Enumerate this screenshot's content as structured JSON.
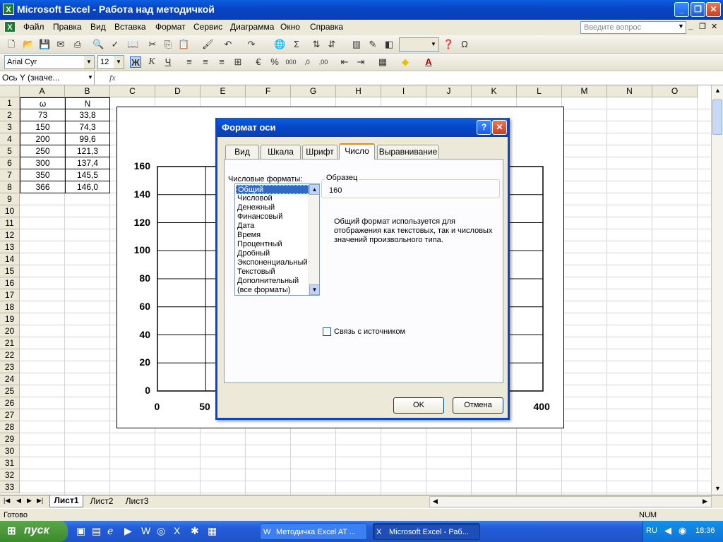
{
  "window": {
    "title": "Microsoft Excel - Работа над методичкой",
    "minimize": "_",
    "restore": "❐",
    "close": "✕"
  },
  "menu": {
    "items": [
      "Файл",
      "Правка",
      "Вид",
      "Вставка",
      "Формат",
      "Сервис",
      "Диаграмма",
      "Окно",
      "Справка"
    ],
    "question_placeholder": "Введите вопрос"
  },
  "format_toolbar": {
    "font": "Arial Cyr",
    "size": "12",
    "bold": "Ж",
    "italic": "К",
    "underline": "Ч"
  },
  "formula_bar": {
    "name_box": "Ось Y (значе...",
    "fx": "fx"
  },
  "columns": [
    "A",
    "B",
    "C",
    "D",
    "E",
    "F",
    "G",
    "H",
    "I",
    "J",
    "K",
    "L",
    "M",
    "N",
    "O"
  ],
  "rows": [
    "1",
    "2",
    "3",
    "4",
    "5",
    "6",
    "7",
    "8",
    "9",
    "10",
    "11",
    "12",
    "13",
    "14",
    "15",
    "16",
    "17",
    "18",
    "19",
    "20",
    "21",
    "22",
    "23",
    "24",
    "25",
    "26",
    "27",
    "28",
    "29",
    "30",
    "31",
    "32",
    "33"
  ],
  "table": {
    "headers": [
      "ω",
      "N"
    ],
    "data": [
      [
        "73",
        "33,8"
      ],
      [
        "150",
        "74,3"
      ],
      [
        "200",
        "99,6"
      ],
      [
        "250",
        "121,3"
      ],
      [
        "300",
        "137,4"
      ],
      [
        "350",
        "145,5"
      ],
      [
        "366",
        "146,0"
      ]
    ]
  },
  "chart_data": {
    "type": "scatter",
    "y_ticks": [
      "160",
      "140",
      "120",
      "100",
      "80",
      "60",
      "40",
      "20",
      "0"
    ],
    "x_ticks": [
      "0",
      "50",
      "400"
    ],
    "ylim": [
      0,
      160
    ],
    "xlim": [
      0,
      400
    ]
  },
  "dialog": {
    "title": "Формат оси",
    "help": "?",
    "close": "✕",
    "tabs": [
      "Вид",
      "Шкала",
      "Шрифт",
      "Число",
      "Выравнивание"
    ],
    "active_tab": "Число",
    "formats_label": "Числовые форматы:",
    "formats": [
      "Общий",
      "Числовой",
      "Денежный",
      "Финансовый",
      "Дата",
      "Время",
      "Процентный",
      "Дробный",
      "Экспоненциальный",
      "Текстовый",
      "Дополнительный",
      "(все форматы)"
    ],
    "selected_format": "Общий",
    "sample_label": "Образец",
    "sample_value": "160",
    "description": "Общий формат используется для отображения как текстовых, так и числовых значений произвольного типа.",
    "link_checkbox": "Связь с источником",
    "ok": "OK",
    "cancel": "Отмена"
  },
  "sheets": [
    "Лист1",
    "Лист2",
    "Лист3"
  ],
  "status": {
    "left": "Готово",
    "right": "NUM"
  },
  "taskbar": {
    "start": "пуск",
    "tasks": [
      "Методичка Excel AT ...",
      "Microsoft Excel - Раб..."
    ],
    "lang": "RU",
    "time": "18:36"
  }
}
